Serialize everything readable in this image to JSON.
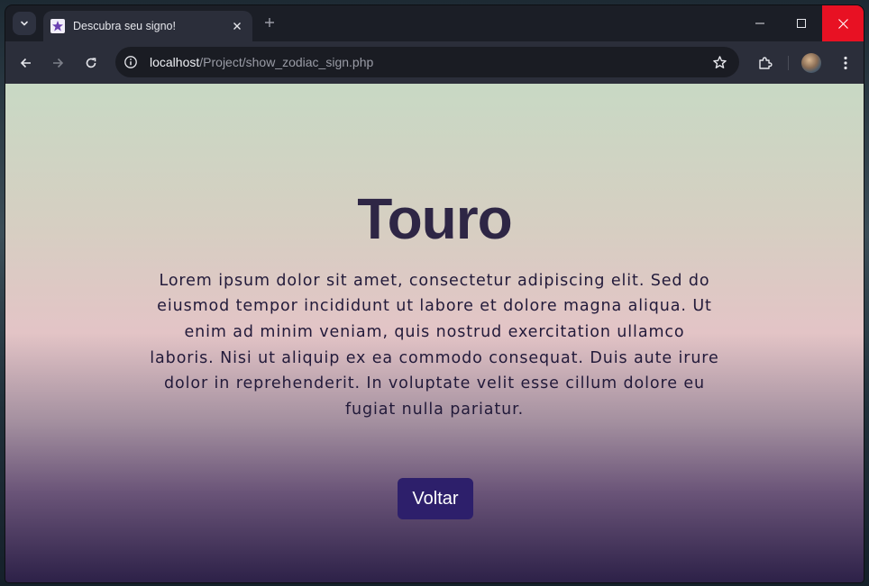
{
  "browser": {
    "tab": {
      "title": "Descubra seu signo!"
    },
    "address": {
      "host": "localhost",
      "path": "/Project/show_zodiac_sign.php"
    }
  },
  "page": {
    "title": "Touro",
    "description": "Lorem ipsum dolor sit amet, consectetur adipiscing elit. Sed do eiusmod tempor incididunt ut labore et dolore magna aliqua. Ut enim ad minim veniam, quis nostrud exercitation ullamco laboris. Nisi ut aliquip ex ea commodo consequat. Duis aute irure dolor in reprehenderit. In voluptate velit esse cillum dolore eu fugiat nulla pariatur.",
    "back_button": "Voltar"
  },
  "colors": {
    "title": "#2e2645",
    "button_bg": "#2d1f6b",
    "close_red": "#e81123"
  },
  "icons": [
    "tab-search-icon",
    "favicon-star-icon",
    "close-tab-icon",
    "new-tab-icon",
    "minimize-icon",
    "maximize-icon",
    "close-window-icon",
    "back-arrow-icon",
    "forward-arrow-icon",
    "reload-icon",
    "site-info-icon",
    "bookmark-star-icon",
    "extensions-icon",
    "profile-avatar",
    "menu-dots-icon"
  ]
}
